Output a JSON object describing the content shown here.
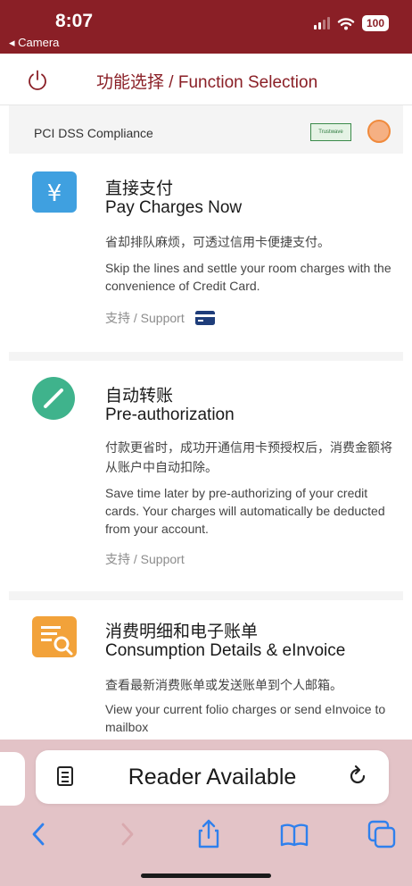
{
  "status_bar": {
    "time": "8:07",
    "back_label": "◂ Camera",
    "battery": "100",
    "icons": [
      "signal-icon",
      "wifi-icon",
      "battery-icon"
    ]
  },
  "header": {
    "title": "功能选择 / Function Selection",
    "power_icon": "power-icon"
  },
  "compliance": {
    "label": "PCI DSS Compliance",
    "trust_badge_text": "Trustwave"
  },
  "cards": [
    {
      "icon": "yen-icon",
      "icon_color": "#3fa0e0",
      "title_cn": "直接支付",
      "title_en": "Pay Charges Now",
      "desc_cn": "省却排队麻烦，可透过信用卡便捷支付。",
      "desc_en": "Skip the lines and settle your room charges with the convenience of Credit Card.",
      "support": "支持 / Support",
      "support_icon": "credit-card-icon"
    },
    {
      "icon": "checkmark-circle-icon",
      "icon_color": "#3fb38c",
      "title_cn": "自动转账",
      "title_en": "Pre-authorization",
      "desc_cn": "付款更省时，成功开通信用卡预授权后，消费金额将从账户中自动扣除。",
      "desc_en": "Save time later by pre-authorizing of your credit cards. Your charges will automatically be deducted from your account.",
      "support": "支持 / Support"
    },
    {
      "icon": "invoice-search-icon",
      "icon_color": "#f2a23a",
      "title_cn": "消费明细和电子账单",
      "title_en": "Consumption Details & eInvoice",
      "desc_cn": "查看最新消费账单或发送账单到个人邮箱。",
      "desc_en": "View your current folio charges or send eInvoice to mailbox"
    }
  ],
  "safari": {
    "reader_label": "Reader Available",
    "reader_icon": "reader-mode-icon",
    "reload_icon": "reload-icon",
    "toolbar": [
      "back-icon",
      "forward-icon",
      "share-icon",
      "bookmarks-icon",
      "tabs-icon"
    ]
  },
  "colors": {
    "brand": "#8a1f26",
    "safari_bg": "#e3c3c7",
    "accent_blue": "#2f80ed"
  }
}
